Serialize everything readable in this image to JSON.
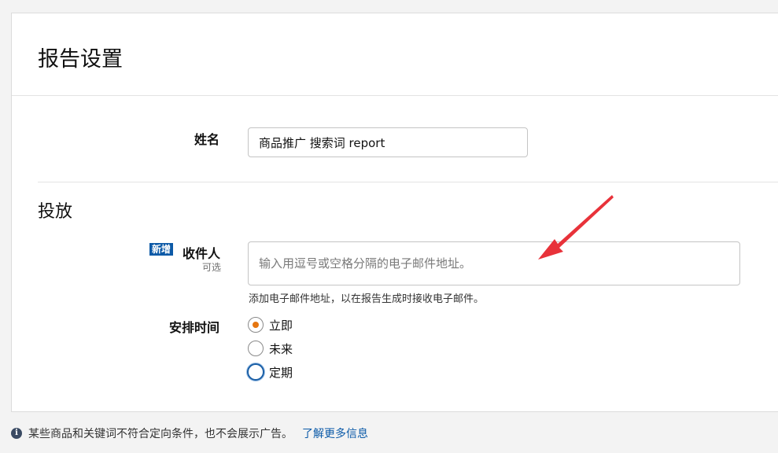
{
  "page": {
    "title": "报告设置"
  },
  "name_field": {
    "label": "姓名",
    "value": "商品推广 搜索词 report"
  },
  "delivery": {
    "section_title": "投放",
    "recipients": {
      "badge": "新增",
      "label": "收件人",
      "optional": "可选",
      "placeholder": "输入用逗号或空格分隔的电子邮件地址。",
      "helper": "添加电子邮件地址，以在报告生成时接收电子邮件。"
    },
    "schedule": {
      "label": "安排时间",
      "options": [
        "立即",
        "未来",
        "定期"
      ],
      "selected": "立即"
    }
  },
  "footer": {
    "notice": "某些商品和关键词不符合定向条件，也不会展示广告。",
    "link": "了解更多信息"
  },
  "colors": {
    "accent_radio": "#e57611",
    "link": "#0b5aa8",
    "badge_bg": "#0d5aa7",
    "annotation_arrow": "#e8323a"
  }
}
